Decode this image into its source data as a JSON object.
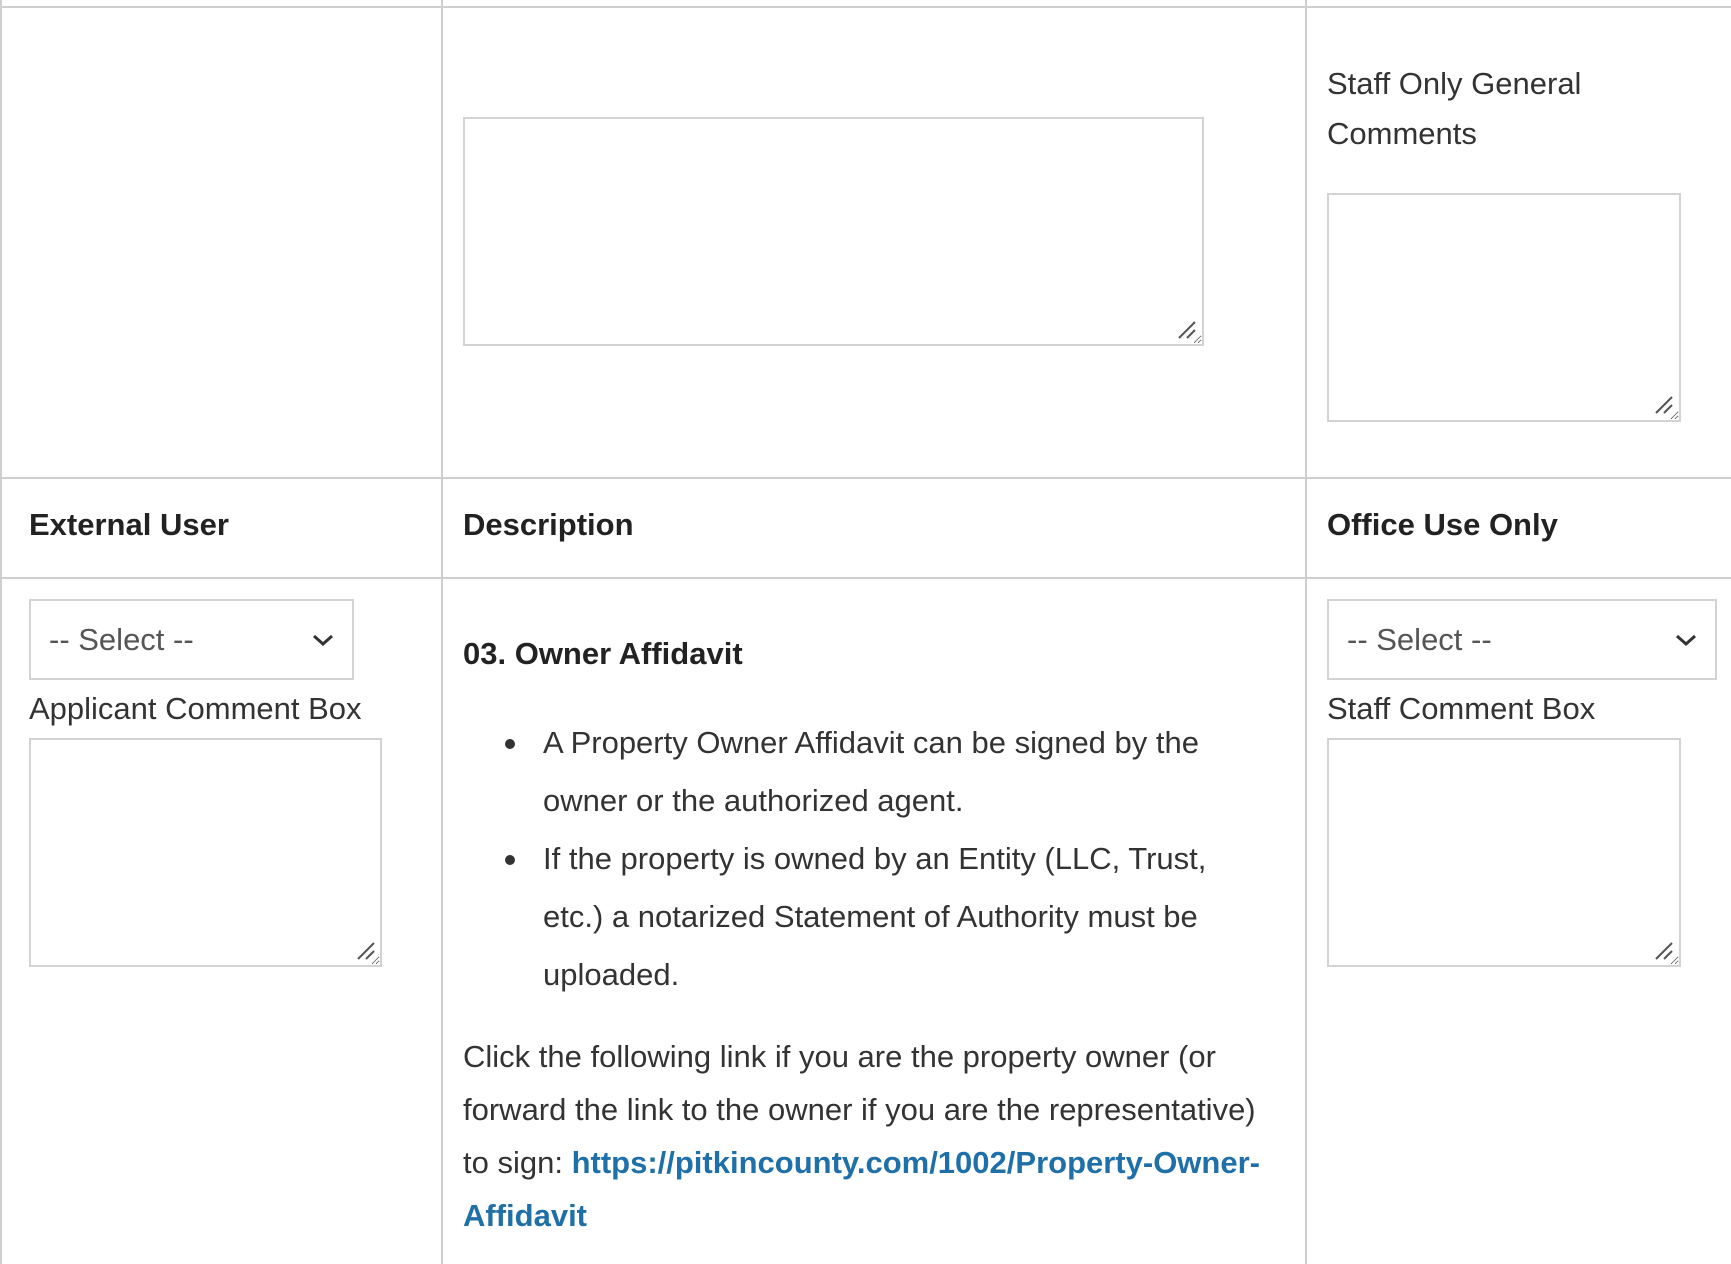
{
  "top_row": {
    "staff_general_label_line1": "Staff Only General",
    "staff_general_label_line2": "Comments"
  },
  "headers": {
    "external_user": "External User",
    "description": "Description",
    "office_use": "Office Use Only"
  },
  "external": {
    "select_value": "-- Select --",
    "comment_label": "Applicant Comment Box"
  },
  "description": {
    "title": "03. Owner Affidavit",
    "bullets": [
      {
        "line1": "A Property Owner Affidavit can be signed by the",
        "line2": "owner or the authorized agent."
      },
      {
        "line1": "If the property is owned by an Entity (LLC, Trust,",
        "line2": "etc.) a notarized Statement of Authority must be",
        "line3": "uploaded."
      }
    ],
    "paragraph": {
      "line1": "Click the following link if you are the property owner (or",
      "line2": "forward the link to the owner if you are the representative)",
      "line3_prefix": "to sign: ",
      "link_part1": "https://pitkincounty.com/1002/Property-Owner-",
      "link_part2": "Affidavit"
    },
    "link_color": "#1f6fa8"
  },
  "office": {
    "select_value": "-- Select --",
    "comment_label": "Staff Comment Box"
  },
  "colors": {
    "border": "#cfcfcf",
    "text": "#333333",
    "link": "#1f6fa8"
  },
  "icons": {
    "select_chevron": "chevron-down-icon",
    "textarea_grip": "resize-grip-icon"
  }
}
